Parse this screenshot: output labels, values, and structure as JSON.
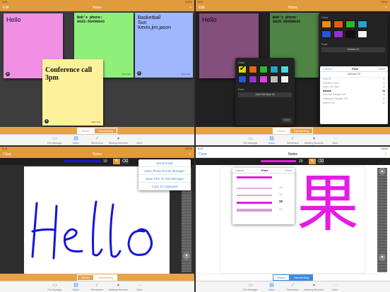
{
  "status": {
    "time": "5:21",
    "right": "100%"
  },
  "nav": {
    "left_edit": "Edit",
    "title": "Notes",
    "right_add": "+",
    "left_clear": "Clear",
    "right_share": "⇪"
  },
  "notes": [
    {
      "text": "Hello",
      "color": "#f08fe4"
    },
    {
      "text": "Bob's phone:\n0025-56498643",
      "color": "#8ef07b"
    },
    {
      "text": "Basketball\nSun\nKevin,jim,jason",
      "color": "#9fb7ff"
    },
    {
      "text": "Conference call\n3pm",
      "color": "#fdf29b"
    }
  ],
  "note_small": "stick note",
  "segments": {
    "sticker": "Sticker",
    "handwriting": "Handwriting"
  },
  "tabs": [
    {
      "label": "File Manager",
      "icon": "folder-icon"
    },
    {
      "label": "Notes",
      "icon": "notes-icon"
    },
    {
      "label": "Reminders",
      "icon": "check-icon"
    },
    {
      "label": "Meeting Recorder",
      "icon": "mic-icon"
    },
    {
      "label": "More",
      "icon": "more-icon"
    }
  ],
  "picker": {
    "color_label": "Color",
    "font_label": "Font",
    "font_button": "Arial Old Style 26",
    "font_button_q2_top": "Kailasa 24",
    "colors": [
      "#e8d800",
      "#e8620d",
      "#2db52d",
      "#2ba0c9",
      "#4ad6d6",
      "#2855d9",
      "#9a2fd1",
      "#e23ce3",
      "#bdbdbd",
      "#f2f2f2"
    ],
    "colors_q2": [
      "#f08a12",
      "#e85a0d",
      "#2db52d",
      "#2ba0c9",
      "#4ad6d6",
      "#2855d9",
      "#9a2fd1",
      "#e23ce3",
      "#111111",
      "#f2f2f2"
    ],
    "done": "Done"
  },
  "font_sheet": {
    "cancel": "Cancel",
    "title": "Font",
    "done": "Done",
    "search": "ABCanrl 20",
    "rows": [
      {
        "name": "Heiti SC",
        "size": "12"
      },
      {
        "name": "Helvetica Neue",
        "size": "14"
      },
      {
        "name": "Iowan Old Style",
        "size": "18"
      },
      {
        "name": "Kailasa",
        "size": "24"
      },
      {
        "name": "Kannada Sangam MN",
        "size": "28"
      },
      {
        "name": "Malayalam Sangam MN",
        "size": "32"
      },
      {
        "name": "Marker Felt",
        "size": "40"
      }
    ],
    "selected_index": 3
  },
  "pen": {
    "size_q3": "10",
    "size_q4": "20",
    "color_q3": "#1515d9",
    "color_q4": "#e51ce5"
  },
  "handwriting": {
    "q3": "Hello",
    "q4": "果"
  },
  "share_menu": [
    "Send Email",
    "Save Photo To File Manager",
    "Save PDF To File Manager",
    "Copy To Clipboard"
  ],
  "size_sheet": {
    "cancel": "Cancel",
    "title": "Font",
    "done": "Done",
    "sizes": [
      "10",
      "15",
      "20",
      "25"
    ],
    "selected": "20"
  },
  "arrows": {
    "up": "▲",
    "down": "▼"
  }
}
